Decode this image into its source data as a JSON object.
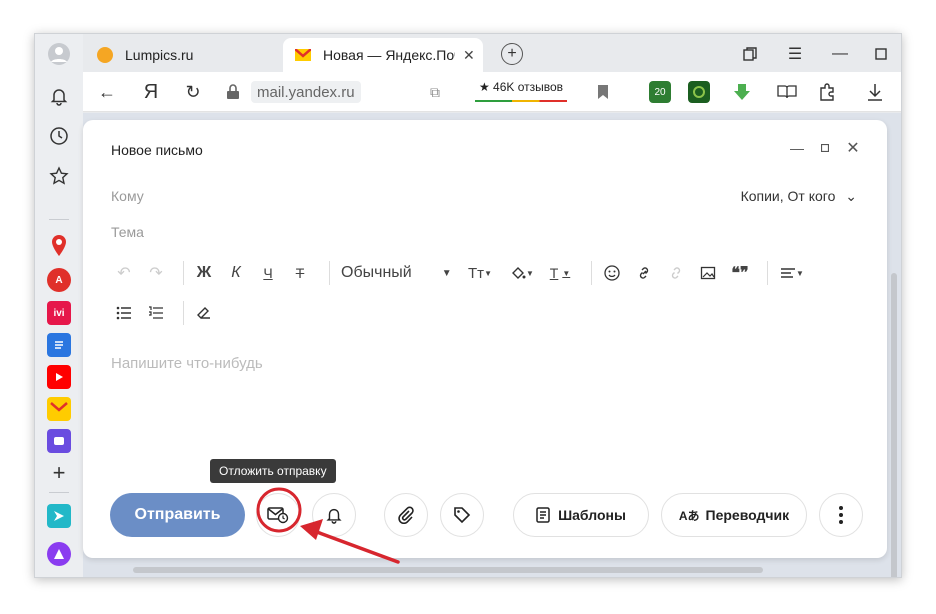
{
  "browser": {
    "tabs": [
      {
        "title": "Lumpics.ru",
        "favicon_color": "#f5a623",
        "active": false
      },
      {
        "title": "Новая — Яндекс.Почта",
        "favicon_color": "#ffcc00",
        "active": true
      }
    ],
    "address": {
      "host": "mail.yandex.ru",
      "brand_letter": "Я"
    },
    "reviews": {
      "label": "★ 46K отзывов"
    },
    "extension_badge": "20"
  },
  "compose": {
    "title": "Новое письмо",
    "to_placeholder": "Кому",
    "copies_label": "Копии, От кого",
    "subject_placeholder": "Тема",
    "format": {
      "bold": "Ж",
      "italic": "К",
      "underline": "Ч",
      "strike": "Т",
      "text_style": "Обычный"
    },
    "body_placeholder": "Напишите что-нибудь",
    "send_label": "Отправить",
    "templates_label": "Шаблоны",
    "translator_label": "Переводчик",
    "translator_glyph": "Aあ",
    "tooltip": "Отложить отправку"
  },
  "colors": {
    "send_button": "#6b8ec6",
    "annotation": "#d7262e"
  },
  "icons": {
    "sidebar": [
      "user-avatar-icon",
      "bell-icon",
      "history-icon",
      "star-icon",
      "maps-icon",
      "translate-icon",
      "ivi-icon",
      "docs-icon",
      "youtube-icon",
      "mail-icon",
      "messenger-icon",
      "plus-icon",
      "zen-icon",
      "alice-icon"
    ]
  }
}
